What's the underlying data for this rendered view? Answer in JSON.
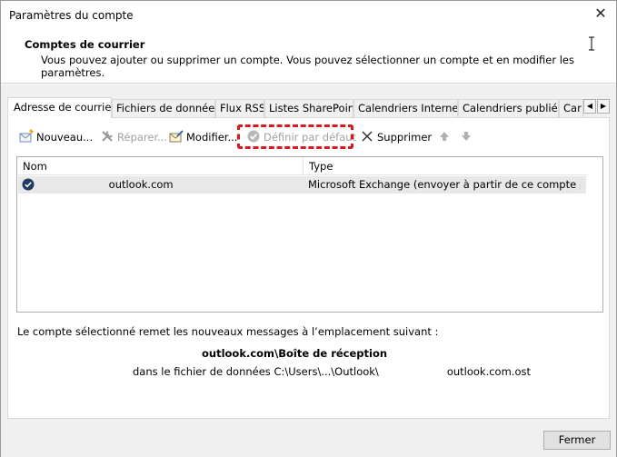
{
  "window": {
    "title": "Paramètres du compte",
    "close_glyph": "✕"
  },
  "header": {
    "title": "Comptes de courrier",
    "description": "Vous pouvez ajouter ou supprimer un compte. Vous pouvez sélectionner un compte et en modifier les paramètres."
  },
  "tabs": [
    {
      "label": "Adresse de courrier",
      "active": true
    },
    {
      "label": "Fichiers de données",
      "active": false
    },
    {
      "label": "Flux RSS",
      "active": false
    },
    {
      "label": "Listes SharePoint",
      "active": false
    },
    {
      "label": "Calendriers Internet",
      "active": false
    },
    {
      "label": "Calendriers publiés",
      "active": false
    },
    {
      "label": "Car",
      "active": false
    }
  ],
  "tab_scroll": {
    "left": "◀",
    "right": "▶"
  },
  "toolbar": {
    "new_label": "Nouveau...",
    "repair_label": "Réparer...",
    "modify_label": "Modifier...",
    "set_default_label": "Définir par défaut",
    "remove_label": "Supprimer",
    "move_up_glyph": "🡅",
    "move_down_glyph": "🡇"
  },
  "accounts_list": {
    "columns": [
      "Nom",
      "Type"
    ],
    "rows": [
      {
        "name_suffix": "outlook.com",
        "type": "Microsoft Exchange (envoyer à partir de ce compte par d..."
      }
    ]
  },
  "delivery_info": {
    "label": "Le compte sélectionné remet les nouveaux messages à l’emplacement suivant :",
    "mailbox_suffix": "outlook.com\\Boîte de réception",
    "file_prefix": "dans le fichier de données C:\\Users\\...\\Outlook\\",
    "file_suffix": "outlook.com.ost"
  },
  "footer": {
    "close_label": "Fermer"
  },
  "colors": {
    "highlight": "#d7191c",
    "selected_row": "#e8e8e8",
    "dialog_bg": "#f0f0f0"
  }
}
